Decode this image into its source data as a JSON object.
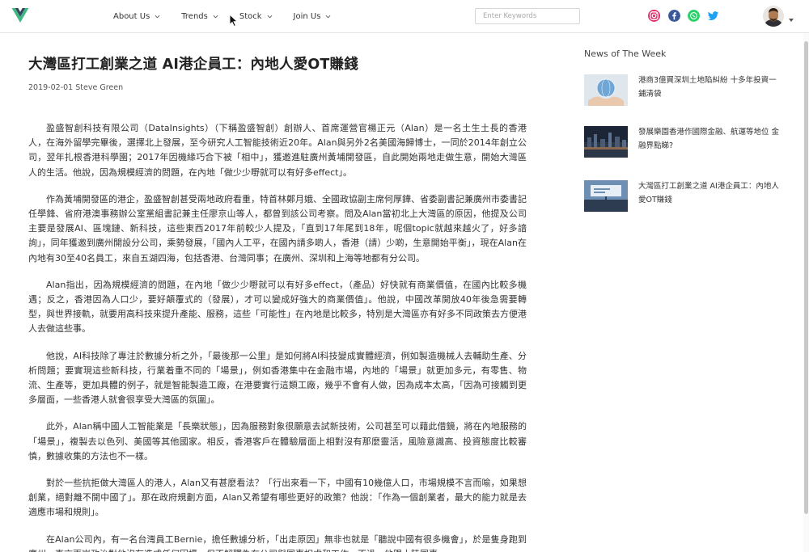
{
  "header": {
    "nav": [
      {
        "label": "About Us"
      },
      {
        "label": "Trends"
      },
      {
        "label": "Stock"
      },
      {
        "label": "Join Us"
      }
    ],
    "search": {
      "placeholder": "Enter Keywords",
      "value": ""
    },
    "social_icons": [
      "instagram-icon",
      "facebook-icon",
      "whatsapp-icon",
      "twitter-icon"
    ],
    "colors": {
      "instagram": "#e1306c",
      "facebook": "#3b5998",
      "whatsapp": "#25d366",
      "twitter": "#1da1f2",
      "logo_green": "#41b883",
      "logo_dark": "#35495e"
    }
  },
  "article": {
    "title": "大灣區打工創業之道 AI港企員工：內地人愛OT賺錢",
    "date": "2019-02-01",
    "author": "Steve Green",
    "paragraphs": [
      "盈盛智創科技有限公司（DataInsights）（下稱盈盛智創）創辦人、首席運營官楊正元（Alan）是一名土生土長的香港人，在海外留學完畢後，選擇北上發展，至今研究人工智能技術近20年。Alan與另外2名美國海歸博士，一同於2014年創立公司，翌年扎根香港科學園；2017年因機緣巧合下被「相中」，獲邀進駐廣州黃埔開發區，自此開始兩地走做生意，開始大灣區人的生活。他說，因為規模經濟的問題，在內地「做少少嘢就可以有好多effect」。",
      "作為黃埔開發區的港企，盈盛智創甚受兩地政府看重，特首林鄭月娥、全國政協副主席何厚鏵、省委副書記兼廣州市委書記任學鋒、省府港澳事務辦公室黨組書記兼主任廖京山等人，都曾到該公司考察。問及Alan當初北上大灣區的原因，他提及公司主要是發展AI、區塊鏈、新科技，這些東西2017年前較少人提及，「直到17年尾到18年，呢個topic就越來越火了，好多諳詢」，同年獲邀到廣州開設分公司，乘勢發展，「國內人工平，在國內請多啲人，香港（請）少啲，生意開始平衡」，現在Alan在內地有30至40名員工，來自五湖四海，包括香港、台灣同事；在廣州、深圳和上海等地都有分公司。",
      "Alan指出，因為規模經濟的問題，在內地「做少少嘢就可以有好多effect，（產品）好快就有商業價值，在國內比較多機遇；反之，香港因為人口少，要好顛覆式的（發展），才可以變成好強大的商業價值」。他說，中國改革開放40年後急需要轉型，與世界接軌，就要用高科技來提升產能、服務，這些「可能性」在內地是比較多，特別是大灣區亦有好多不同政策去方便港人去做這些事。",
      "他說，AI科技除了專注於數據分析之外，「最後那一公里」是如何將AI科技變成實體經濟，例如製造機械人去輔助生產、分析問題；要實現這些新科技，行業着重不同的「場景」，例如香港集中在金融市場，內地的「場景」就更加多元，有零售、物流、生產等，更加具體的例子，就是智能製造工廠，在港要實行這類工廠，幾乎不會有人做，因為成本太高，「因為可接觸到更多層面，一些香港人就會很享受大灣區的氛圍」。",
      "此外，Alan稱中國人工智能業是「長樂狀態」，因為服務對象很願意去試新技術，公司甚至可以藉此借鏡，將在內地服務的「場景」，複製去以色列、美國等其他國家。相反，香港客戶在體驗層面上相對沒有那麼靈活，風險意識高、投資態度比較審慎，數據收集的方法也不一樣。",
      "對於一些抗拒做大灣區人的港人，Alan又有甚麼看法？「行出來看一下，中國有10幾億人口，市場規模不言而喻，如果想創業，絕對離不開中國了」。那在政府規劃方面，Alan又希望有哪些更好的政策？他說：「作為一個創業者，最大的能力就是去適應市場和規則」。",
      "在Alan公司內，有一名台灣員工Bernie，擔任數據分析，「出走原因」無非也就是「聽說中國有很多機會」，於是隻身跑到廣州，直言兩岸政治對他沒有造成任何困擾，但不解釋為在公司與同事相處和工作，不過，他跟大陸同事"
    ]
  },
  "sidebar": {
    "heading": "News of The Week",
    "items": [
      {
        "text": "港商3億買深圳土地陷糾紛 十多年投資一鋪清袋",
        "thumb": "globe-hands-thumbnail"
      },
      {
        "text": "發展樂園香港作國際金融、航運等地位 金融界點睇?",
        "thumb": "city-night-thumbnail"
      },
      {
        "text": "大灣區打工創業之道 AI港企員工：內地人愛OT賺錢",
        "thumb": "billboard-thumbnail"
      }
    ]
  }
}
